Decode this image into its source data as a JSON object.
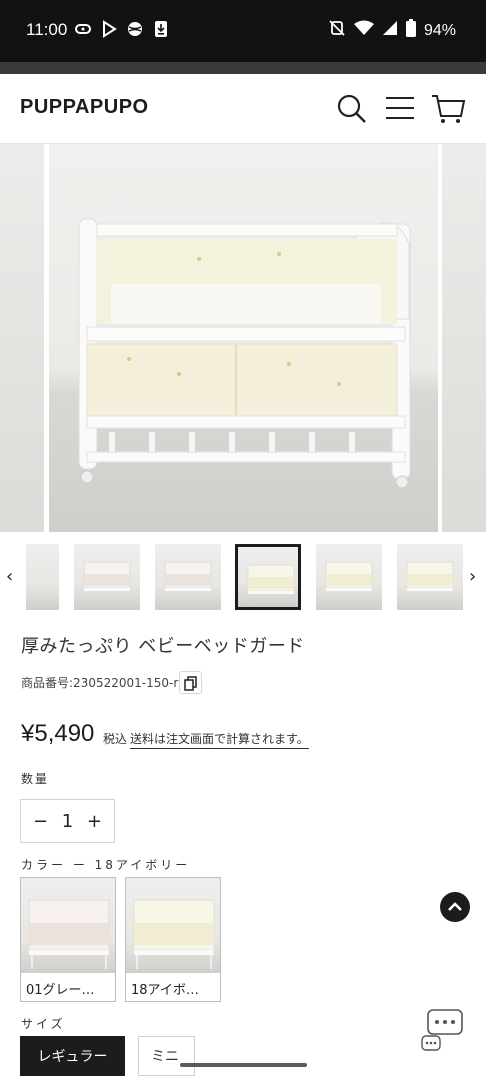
{
  "status_bar": {
    "time": "11:00",
    "battery": "94%"
  },
  "header": {
    "logo": "PUPPAPUPO",
    "icons": [
      "search-icon",
      "menu-icon",
      "cart-icon"
    ]
  },
  "gallery": {
    "thumbnail_count": 6,
    "active_thumbnail": 4
  },
  "product": {
    "title": "厚みたっぷり ベビーベッドガード",
    "sku": "商品番号:230522001-150-r",
    "price": "¥5,490",
    "tax_label": "税込",
    "shipping_note": "送料は注文画面で計算されます。"
  },
  "quantity": {
    "label": "数量",
    "value": "1",
    "minus": "−",
    "plus": "+"
  },
  "color": {
    "label": "カラー ー 18アイボリー",
    "options": [
      {
        "label": "01グレー…"
      },
      {
        "label": "18アイボ…"
      }
    ]
  },
  "size": {
    "label": "サイズ",
    "options": [
      "レギュラー",
      "ミニ"
    ]
  },
  "colors": {
    "status_bg": "#121212",
    "text_dark": "#1c1c1c",
    "ivory": "#f3efdc",
    "grey_pad": "#e9e4df"
  }
}
